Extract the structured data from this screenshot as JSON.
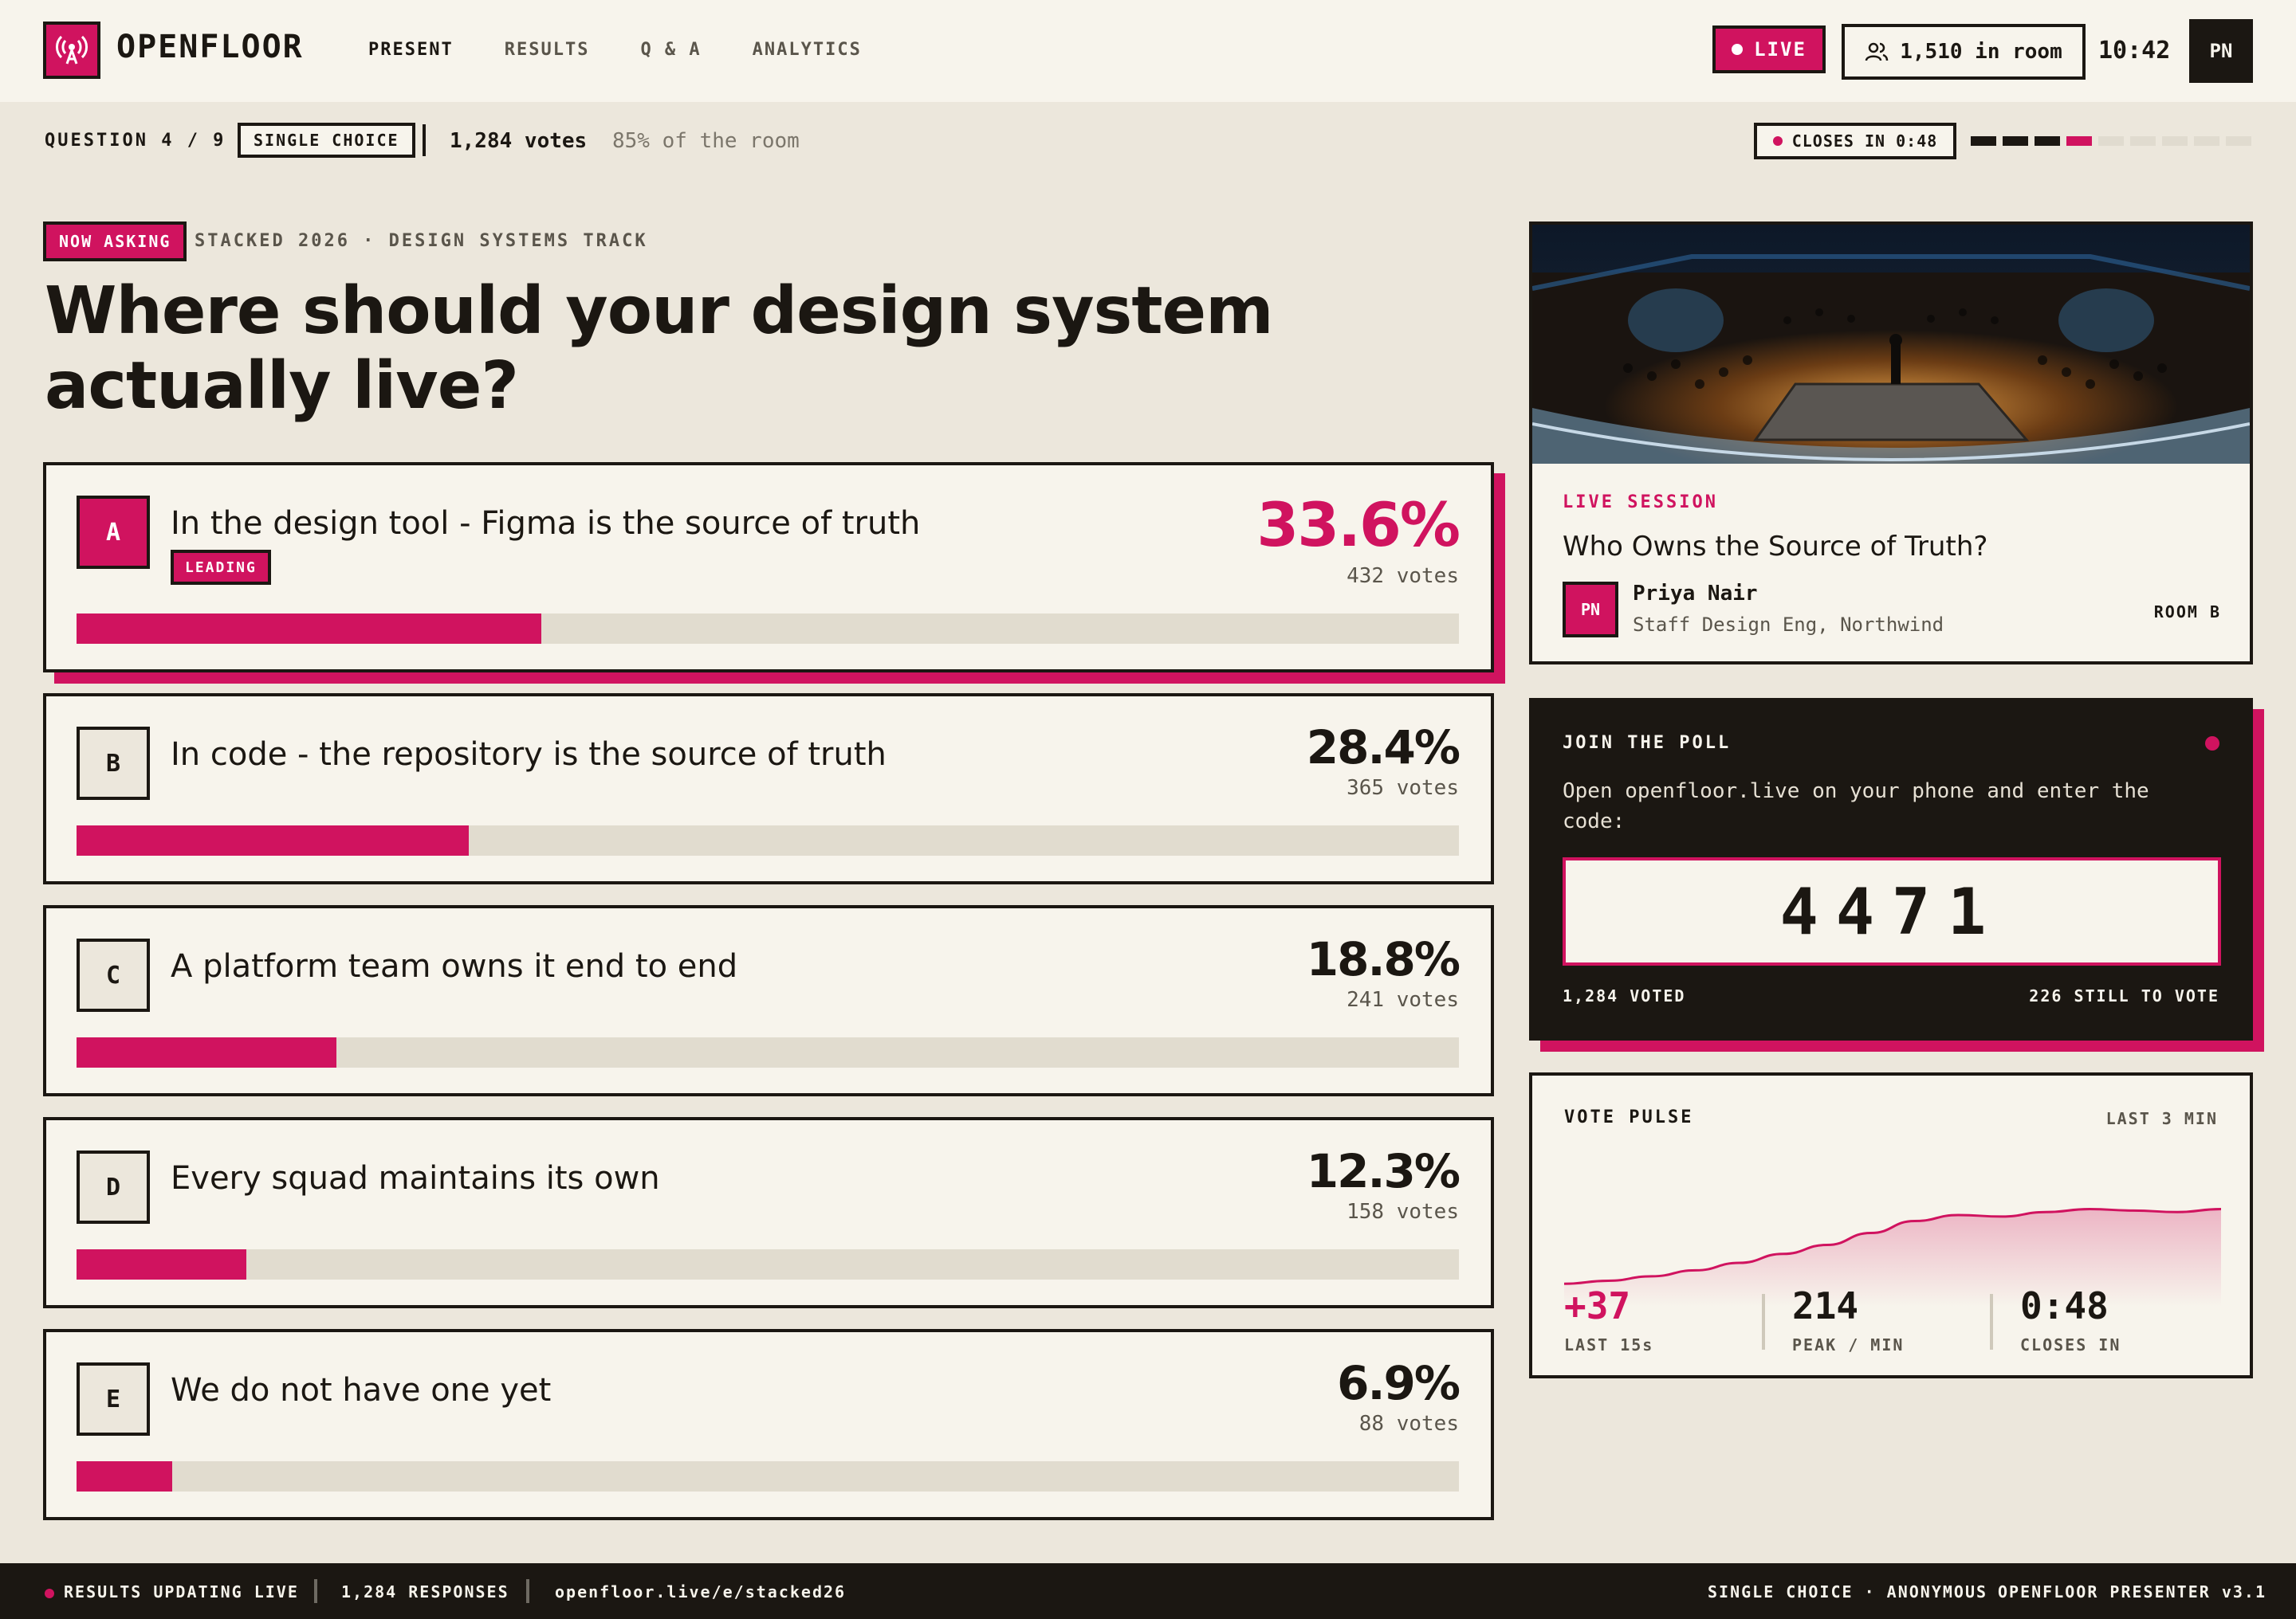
{
  "nav": {
    "brand": "OPENFLOOR",
    "links": [
      {
        "label": "PRESENT",
        "active": true
      },
      {
        "label": "RESULTS",
        "active": false
      },
      {
        "label": "Q & A",
        "active": false
      },
      {
        "label": "ANALYTICS",
        "active": false
      }
    ],
    "live_label": "LIVE",
    "room_count": "1,510 in room",
    "clock": "10:42",
    "user_initials": "PN"
  },
  "subbar": {
    "question_num": "QUESTION 4 / 9",
    "question_type": "SINGLE CHOICE",
    "votes": "1,284 votes",
    "room_pct": "85% of the room",
    "closes": "CLOSES IN 0:48",
    "progress": {
      "completed": 3,
      "current": 4,
      "total": 9
    }
  },
  "question": {
    "badge": "NOW ASKING",
    "track": "STACKED 2026 · DESIGN SYSTEMS TRACK",
    "title": "Where should your design system actually live?"
  },
  "options": [
    {
      "letter": "A",
      "text": "In the design tool - Figma is the source of truth",
      "pct": "33.6%",
      "votes": "432 votes",
      "share": 0.336,
      "leading": true,
      "tag": "LEADING"
    },
    {
      "letter": "B",
      "text": "In code - the repository is the source of truth",
      "pct": "28.4%",
      "votes": "365 votes",
      "share": 0.284,
      "leading": false
    },
    {
      "letter": "C",
      "text": "A platform team owns it end to end",
      "pct": "18.8%",
      "votes": "241 votes",
      "share": 0.188,
      "leading": false
    },
    {
      "letter": "D",
      "text": "Every squad maintains its own",
      "pct": "12.3%",
      "votes": "158 votes",
      "share": 0.123,
      "leading": false
    },
    {
      "letter": "E",
      "text": "We do not have one yet",
      "pct": "6.9%",
      "votes": "88 votes",
      "share": 0.069,
      "leading": false
    }
  ],
  "session": {
    "label": "LIVE SESSION",
    "title": "Who Owns the Source of Truth?",
    "speaker_initials": "PN",
    "speaker_name": "Priya Nair",
    "speaker_role": "Staff Design Eng, Northwind",
    "room": "ROOM B"
  },
  "join": {
    "title": "JOIN THE POLL",
    "description": "Open openfloor.live on your phone and enter the code:",
    "code": "4471",
    "voted": "1,284 VOTED",
    "still": "226 STILL TO VOTE"
  },
  "pulse": {
    "title": "VOTE PULSE",
    "range": "LAST 3 MIN",
    "series": [
      10,
      12,
      15,
      19,
      24,
      30,
      36,
      44,
      52,
      56,
      55,
      58,
      60,
      59,
      58,
      60
    ],
    "stats": [
      {
        "value": "+37",
        "label": "LAST 15s"
      },
      {
        "value": "214",
        "label": "PEAK / MIN"
      },
      {
        "value": "0:48",
        "label": "CLOSES IN"
      }
    ]
  },
  "footer": {
    "status": "RESULTS UPDATING LIVE",
    "responses": "1,284 RESPONSES",
    "url": "openfloor.live/e/stacked26",
    "mode": "SINGLE CHOICE · ANONYMOUS",
    "version": "OPENFLOOR PRESENTER v3.1"
  },
  "colors": {
    "accent": "#d0135f",
    "ink": "#1b1712",
    "paper": "#f7f4ec",
    "bg": "#ece7dc"
  }
}
